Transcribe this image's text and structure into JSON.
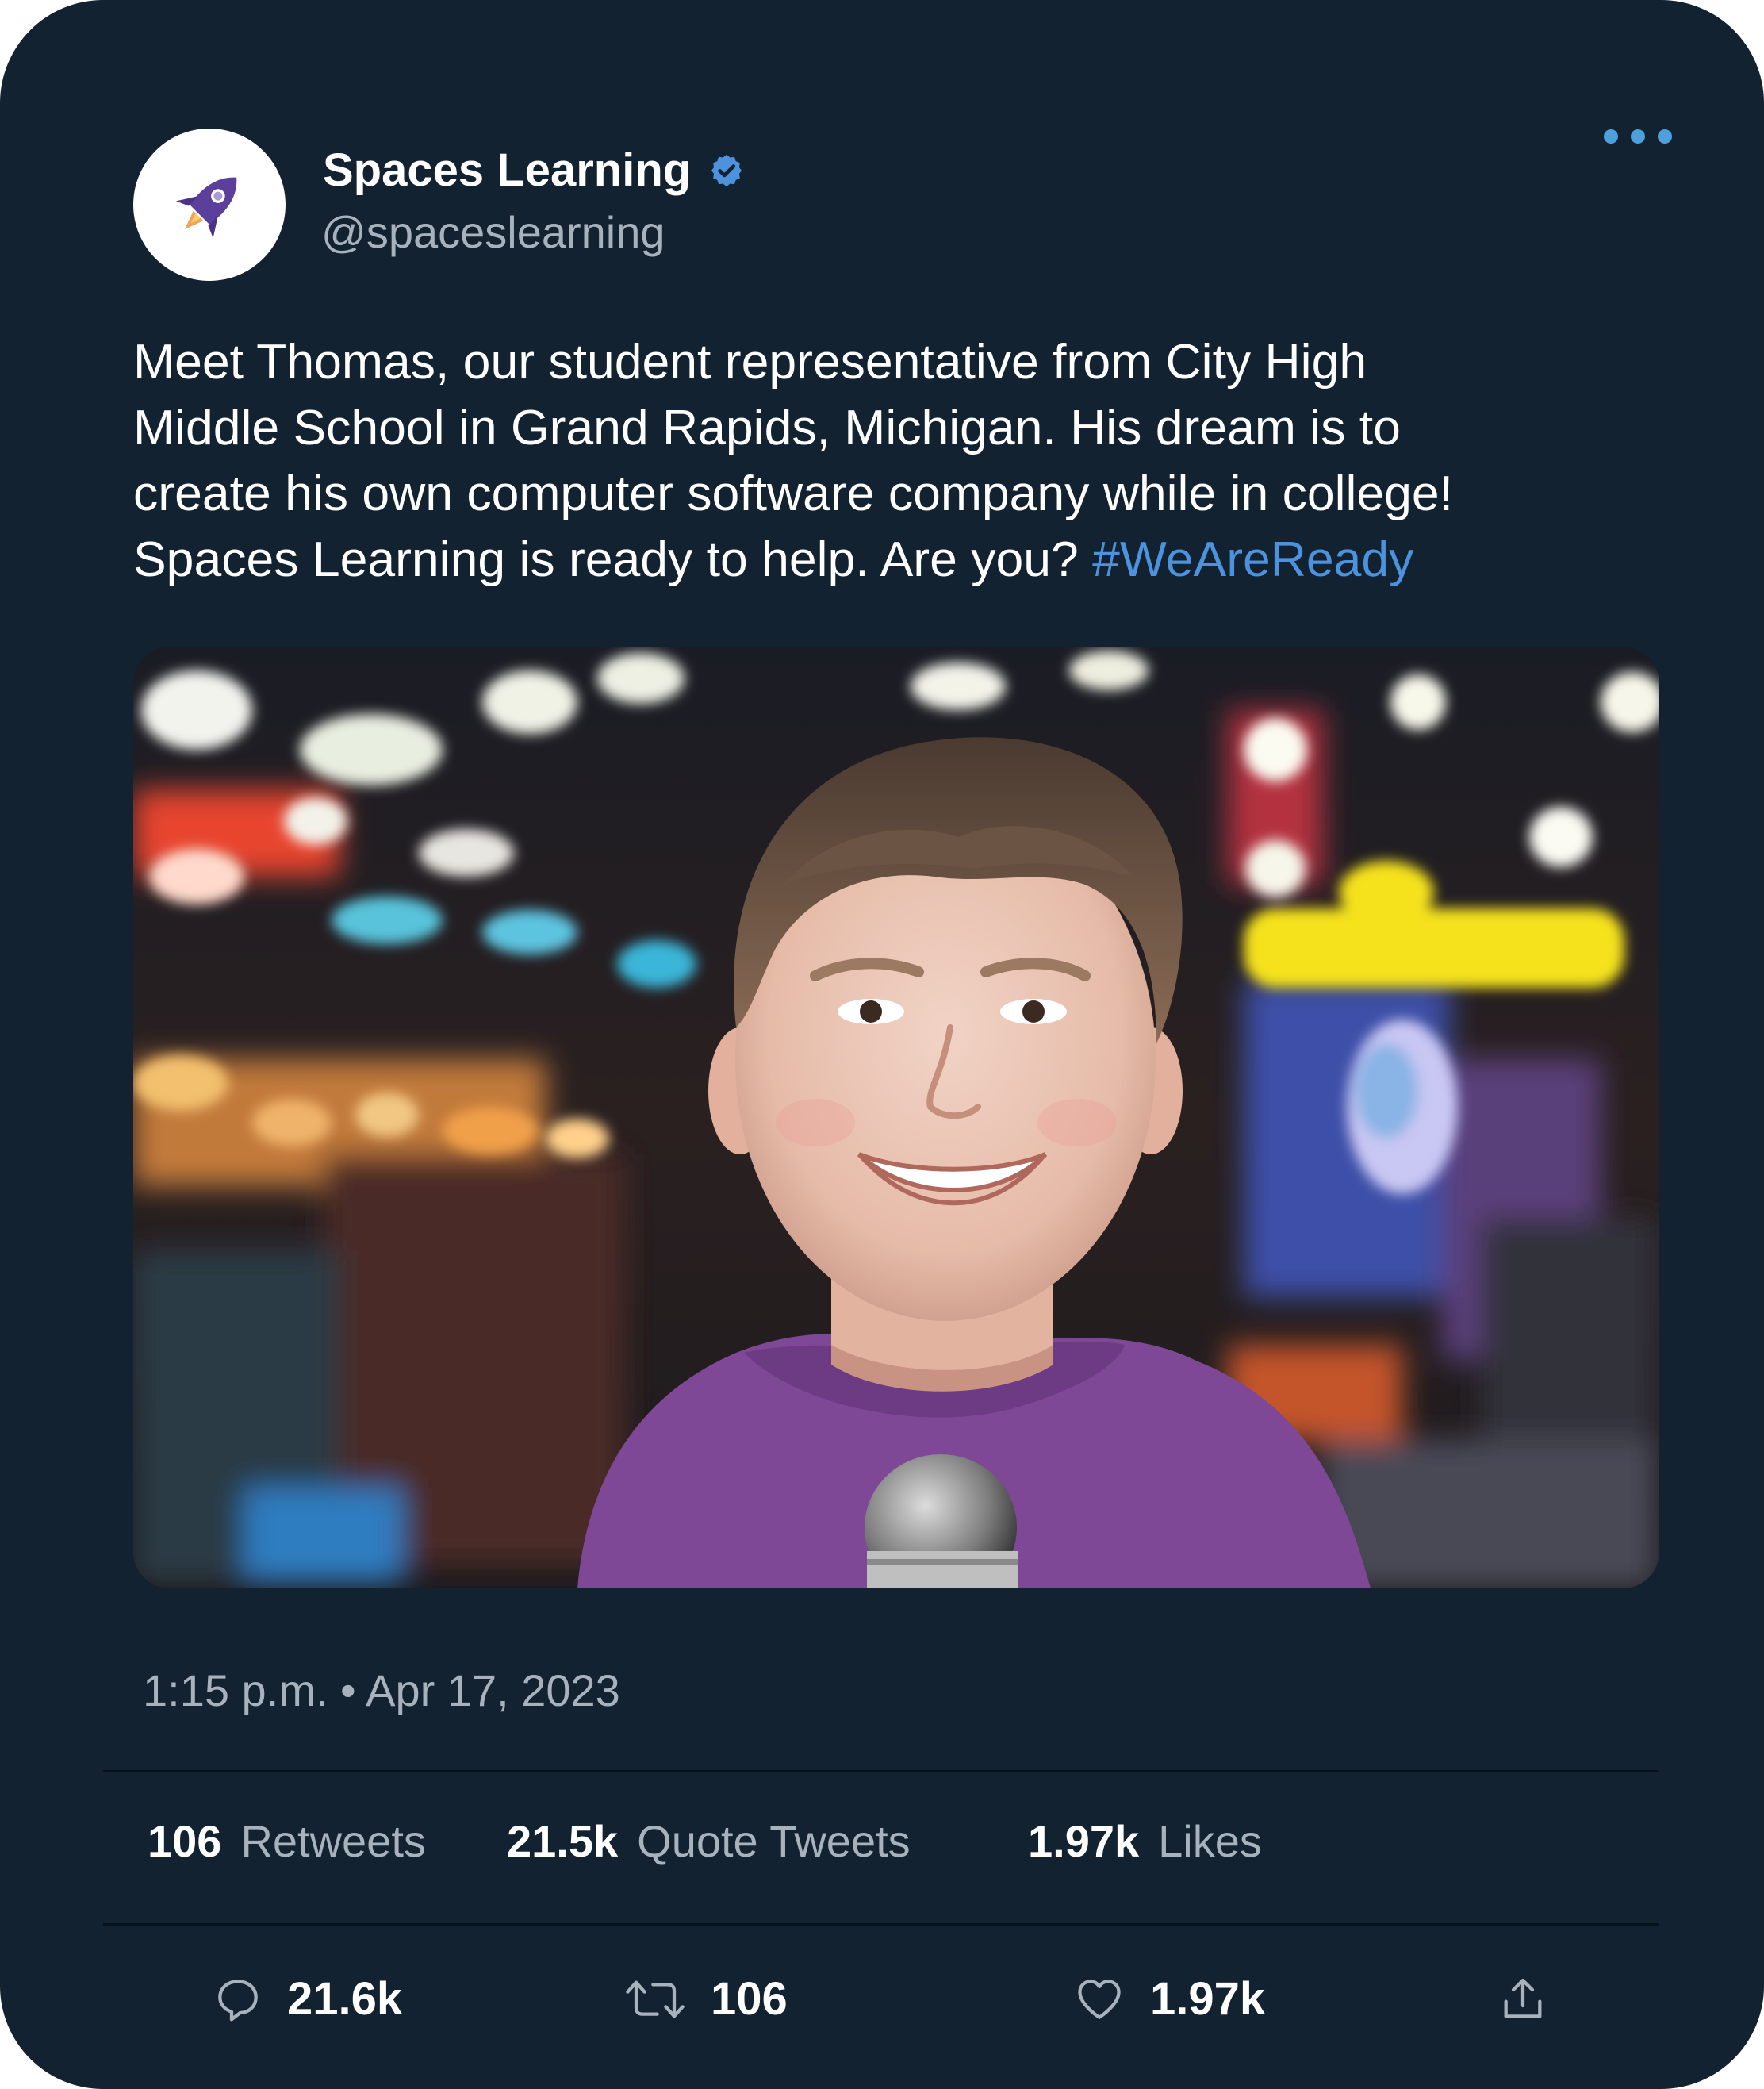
{
  "tweet": {
    "author_name": "Spaces Learning",
    "author_handle": "@spaceslearning",
    "text_lines": [
      "Meet Thomas, our student representative from City High",
      "Middle School in Grand Rapids, Michigan. His dream is to",
      "create his own computer software company while in college!",
      "Spaces Learning is ready to help. Are you?"
    ],
    "hashtag": "#WeAreReady",
    "timestamp": "1:15 p.m. • Apr 17, 2023"
  },
  "stats": {
    "retweets_count": "106",
    "retweets_label": "Retweets",
    "quotes_count": "21.5k",
    "quotes_label": "Quote Tweets",
    "likes_count": "1.97k",
    "likes_label": "Likes"
  },
  "actions": {
    "reply_count": "21.6k",
    "retweet_count": "106",
    "like_count": "1.97k"
  },
  "icons": {
    "avatar": "rocket-icon",
    "verified": "verified-badge-icon",
    "more": "more-options-icon",
    "reply": "reply-icon",
    "retweet": "retweet-icon",
    "like": "heart-icon",
    "share": "share-icon"
  },
  "colors": {
    "background": "#132230",
    "accent": "#4d92dc",
    "muted_text": "#a7b2bd",
    "avatar_rocket": "#5b3f9a"
  }
}
